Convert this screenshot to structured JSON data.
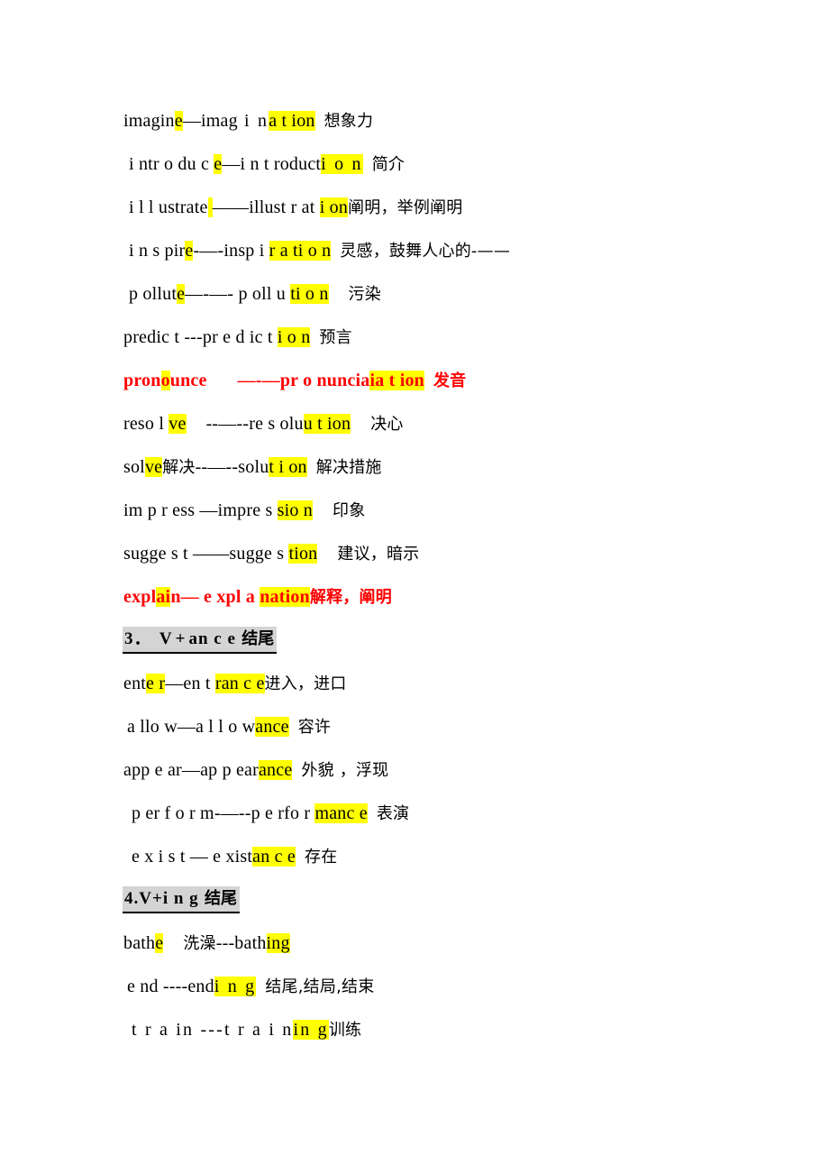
{
  "document": {
    "title": "English word formation notes — noun suffixes",
    "colors": {
      "highlight": "#ffff00",
      "red_text": "#ff0000",
      "heading_background": "#d4d4d4",
      "page_background": "#ffffff",
      "body_text": "#000000"
    },
    "sections": [
      {
        "heading": null,
        "entries": [
          {
            "id": "imagine",
            "full_text": "imagine—imagination 想象力",
            "verb": "imagine",
            "noun": "imagination",
            "gloss": "想象力",
            "style": "normal",
            "indent": 0
          },
          {
            "id": "introduce",
            "full_text": "introduce—introduction 简介",
            "verb": "introduce",
            "noun": "introduction",
            "gloss": "简介",
            "style": "normal",
            "indent": 1
          },
          {
            "id": "illustrate",
            "full_text": "illustrate ——illustration 阐明，举例阐明",
            "verb": "illustrate",
            "noun": "illustration",
            "gloss": "阐明，举例阐明",
            "style": "normal",
            "indent": 1
          },
          {
            "id": "inspire",
            "full_text": "inspire-—-inspiration 灵感，鼓舞人心的-——",
            "verb": "inspire",
            "noun": "inspiration",
            "gloss": "灵感，鼓舞人心的-——",
            "style": "normal",
            "indent": 1
          },
          {
            "id": "pollute",
            "full_text": "pollute—-—-pollution 污染",
            "verb": "pollute",
            "noun": "pollution",
            "gloss": "污染",
            "style": "normal",
            "indent": 1
          },
          {
            "id": "predict",
            "full_text": "predict---prediction 预言",
            "verb": "predict",
            "noun": "prediction",
            "gloss": "预言",
            "style": "normal",
            "indent": 0
          },
          {
            "id": "pronounce",
            "full_text": "pronounce —-—pronunciation 发音",
            "verb": "pronounce",
            "noun": "pronunciation",
            "gloss": "发音",
            "style": "red-bold",
            "indent": 0
          },
          {
            "id": "resolve",
            "full_text": "resolve --—--resolution 决心",
            "verb": "resolve",
            "noun": "resolution",
            "gloss": "决心",
            "style": "normal",
            "indent": 0
          },
          {
            "id": "solve",
            "full_text": "solve 解决--—--solution 解决措施",
            "verb": "solve",
            "noun": "solution",
            "gloss": "解决措施",
            "verb_gloss": "解决",
            "style": "normal",
            "indent": 0
          },
          {
            "id": "impress",
            "full_text": "impress—impression 印象",
            "verb": "impress",
            "noun": "impression",
            "gloss": "印象",
            "style": "normal",
            "indent": 0
          },
          {
            "id": "suggest",
            "full_text": "suggest ——suggestion 建议，暗示",
            "verb": "suggest",
            "noun": "suggestion",
            "gloss": "建议，暗示",
            "style": "normal",
            "indent": 0
          },
          {
            "id": "explain",
            "full_text": "explain— explanation 解释，阐明",
            "verb": "explain",
            "noun": "explanation",
            "gloss": "解释，阐明",
            "style": "red-bold",
            "indent": 0
          }
        ]
      },
      {
        "heading": {
          "number": "3．",
          "pattern": "V+ance",
          "suffix_label": "结尾",
          "text": "3．V+ance 结尾"
        },
        "entries": [
          {
            "id": "enter",
            "full_text": "enter—entrance 进入，进口",
            "verb": "enter",
            "noun": "entrance",
            "gloss": "进入，进口",
            "style": "normal",
            "indent": 0
          },
          {
            "id": "allow",
            "full_text": "allow—allowance 容许",
            "verb": "allow",
            "noun": "allowance",
            "gloss": "容许",
            "style": "normal",
            "indent": 1
          },
          {
            "id": "appear",
            "full_text": "appear—appearance 外貌 ，浮现",
            "verb": "appear",
            "noun": "appearance",
            "gloss": "外貌 ，浮现",
            "style": "normal",
            "indent": 0
          },
          {
            "id": "perform",
            "full_text": "perform-—--performance 表演",
            "verb": "perform",
            "noun": "performance",
            "gloss": "表演",
            "style": "normal",
            "indent": 1
          },
          {
            "id": "exist",
            "full_text": "exist—existance 存在",
            "verb": "exist",
            "noun": "existance",
            "gloss": "存在",
            "style": "normal",
            "indent": 1
          }
        ]
      },
      {
        "heading": {
          "number": "4.",
          "pattern": "V+ing",
          "suffix_label": "结尾",
          "text": "4.V+ing 结尾"
        },
        "entries": [
          {
            "id": "bathe",
            "full_text": "bathe 洗澡---bathing",
            "verb": "bathe",
            "noun": "bathing",
            "gloss": "",
            "verb_gloss": "洗澡",
            "style": "normal",
            "indent": 0
          },
          {
            "id": "end",
            "full_text": "end----ending 结尾,结局,结束",
            "verb": "end",
            "noun": "ending",
            "gloss": "结尾,结局,结束",
            "style": "normal",
            "indent": 1
          },
          {
            "id": "train",
            "full_text": "train ---training 训练",
            "verb": "train",
            "noun": "training",
            "gloss": "训练",
            "style": "normal",
            "indent": 1
          }
        ]
      }
    ]
  },
  "lines": {
    "imagine": {
      "p1": "imagin",
      "h1": "e",
      "p2": "—imag",
      "p3": " i n",
      "h2": "a",
      "h2b": " t",
      "h2c": " ion",
      "cn": "想象力"
    },
    "introduce": {
      "p1": " i ntr o du c ",
      "h1": "e",
      "p2": "—i n",
      "p3": " t roduct",
      "h2": "i  o  n",
      "cn": "简介"
    },
    "illustrate": {
      "p1": " i l l ustrate",
      "h1": " ",
      "p2": " ——illust",
      "p3": " r at ",
      "h2": "i on",
      "cn": "阐明，举例阐明"
    },
    "inspire": {
      "p1": " i n s pir",
      "h1": "e",
      "p2": "-—-insp",
      "p3": " i ",
      "h2": "r a ti o n",
      "cn": "灵感，鼓舞人心的-——"
    },
    "pollute": {
      "p1": " p ollut",
      "h1": "e",
      "p2": "—-—- p oll u ",
      "h2": "ti o n",
      "cn": "污染"
    },
    "predict": {
      "p1": "predic t ---pr e  d ic t ",
      "h2": "i o n",
      "cn": "预言"
    },
    "pronounce": {
      "p1": "pron",
      "h1": "o",
      "p2": "unce",
      "p3": "—-—pr o nuncia",
      "h2": "ia t ion",
      "cn": "发音"
    },
    "resolve": {
      "p1": "reso l ",
      "h1": "ve",
      "p2": "--—--re s olu",
      "h2": "u t ion",
      "cn": "决心"
    },
    "solve": {
      "p1": "sol",
      "h1": "ve",
      "cn1": "解决",
      "p2": "--—--solu",
      "h2": "t  i on",
      "cn": "解决措施"
    },
    "impress": {
      "p1": "im p  r ess —impre s ",
      "h2": "sio n",
      "cn": "印象"
    },
    "suggest": {
      "p1": "sugge s t ——sugge s ",
      "h2": "tion",
      "cn": "建议，暗示"
    },
    "explain": {
      "p1": "expl",
      "h1": "ai",
      "p2": "n— e xpl a ",
      "h2": "nation",
      "cn": "解释，阐明"
    },
    "enter": {
      "p1": "ent",
      "h1": "e r",
      "p2": "—en t ",
      "h2": "ran c e",
      "cn": "进入，进口"
    },
    "allow": {
      "p1": " a llo w—a l  l  o w",
      "h2": "ance",
      "cn": "容许"
    },
    "appear": {
      "p1": "app e ar—ap p ear",
      "h2": "ance",
      "cn": "外貌 ，浮现"
    },
    "perform": {
      "p1": " p er f o  r m-—--p e rfo  r ",
      "h2": "manc e",
      "cn": "表演"
    },
    "exist": {
      "p1": " e  x  i s t — e xist",
      "h2": "an c e",
      "cn": "存在"
    },
    "bathe": {
      "p1": "bath",
      "h1": "e",
      "cn1": "洗澡",
      "p2": "---bath",
      "h2": "ing",
      "cn": ""
    },
    "end": {
      "p1": " e nd ----end",
      "h2": "i n  g",
      "cn": "结尾,结局,结束"
    },
    "train": {
      "p1": " t r a in   ---t r a i n",
      "h2": "in g",
      "cn": "训练"
    }
  },
  "headings": {
    "ance": {
      "num": "3．",
      "pattern_a": " V+",
      "pattern_b": "an c e",
      "label": " 结尾"
    },
    "ing": {
      "num": "4.",
      "pattern_a": "V+",
      "pattern_b": "i n g",
      "label": " 结尾"
    }
  }
}
